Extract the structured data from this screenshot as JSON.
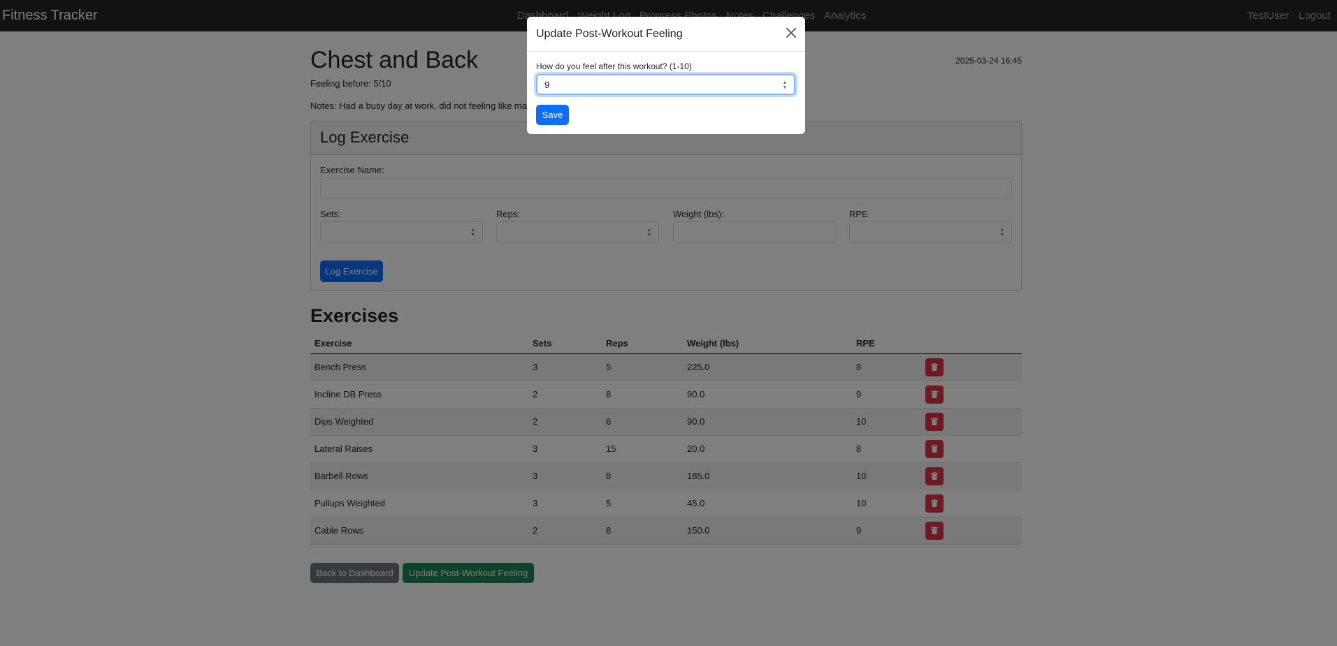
{
  "navbar": {
    "brand": "Fitness Tracker",
    "links": [
      "Dashboard",
      "Weight Log",
      "Progress Photos",
      "Notes",
      "Challenges",
      "Analytics"
    ],
    "user": "TestUser",
    "logout": "Logout"
  },
  "workout": {
    "title": "Chest and Back",
    "date": "2025-03-24 16:45",
    "feeling_before": "Feeling before: 5/10",
    "notes": "Notes: Had a busy day at work, did not feeling like making it to the gym"
  },
  "log_form": {
    "header": "Log Exercise",
    "exercise_label": "Exercise Name:",
    "sets_label": "Sets:",
    "reps_label": "Reps:",
    "weight_label": "Weight (lbs):",
    "rpe_label": "RPE",
    "submit": "Log Exercise"
  },
  "exercises": {
    "title": "Exercises",
    "columns": [
      "Exercise",
      "Sets",
      "Reps",
      "Weight (lbs)",
      "RPE"
    ],
    "rows": [
      {
        "name": "Bench Press",
        "sets": "3",
        "reps": "5",
        "weight": "225.0",
        "rpe": "8"
      },
      {
        "name": "Incline DB Press",
        "sets": "2",
        "reps": "8",
        "weight": "90.0",
        "rpe": "9"
      },
      {
        "name": "Dips Weighted",
        "sets": "2",
        "reps": "6",
        "weight": "90.0",
        "rpe": "10"
      },
      {
        "name": "Lateral Raises",
        "sets": "3",
        "reps": "15",
        "weight": "20.0",
        "rpe": "8"
      },
      {
        "name": "Barbell Rows",
        "sets": "3",
        "reps": "8",
        "weight": "185.0",
        "rpe": "10"
      },
      {
        "name": "Pullups Weighted",
        "sets": "3",
        "reps": "5",
        "weight": "45.0",
        "rpe": "10"
      },
      {
        "name": "Cable Rows",
        "sets": "2",
        "reps": "8",
        "weight": "150.0",
        "rpe": "9"
      }
    ]
  },
  "actions": {
    "back": "Back to Dashboard",
    "update": "Update Post-Workout Feeling"
  },
  "modal": {
    "title": "Update Post-Workout Feeling",
    "label": "How do you feel after this workout? (1-10)",
    "value": "9",
    "save": "Save"
  },
  "colors": {
    "navbar": "#212529",
    "primary": "#0d6efd",
    "secondary": "#6c757d",
    "success": "#198754",
    "danger": "#dc3545"
  },
  "icons": {
    "delete": "trash-icon",
    "close": "close-icon",
    "spinner": "spinner-arrows-icon"
  }
}
